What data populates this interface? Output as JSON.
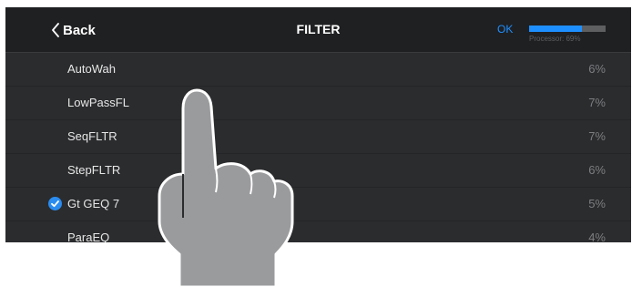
{
  "navbar": {
    "back_label": "Back",
    "title": "FILTER",
    "ok_label": "OK",
    "processor": {
      "label": "Processor: 69%",
      "percent": 69
    }
  },
  "effects": [
    {
      "name": "AutoWah",
      "usage": "6%",
      "selected": false
    },
    {
      "name": "LowPassFL",
      "usage": "7%",
      "selected": false
    },
    {
      "name": "SeqFLTR",
      "usage": "7%",
      "selected": false
    },
    {
      "name": "StepFLTR",
      "usage": "6%",
      "selected": false
    },
    {
      "name": "Gt GEQ 7",
      "usage": "5%",
      "selected": true
    },
    {
      "name": "ParaEQ",
      "usage": "4%",
      "selected": false
    }
  ],
  "colors": {
    "accent": "#1e8fff",
    "background": "#2b2c2e",
    "navbar": "#1f2022"
  },
  "icons": {
    "back": "chevron-left-icon",
    "selected": "checkmark-circle-icon",
    "gesture": "tap-hand-icon"
  }
}
